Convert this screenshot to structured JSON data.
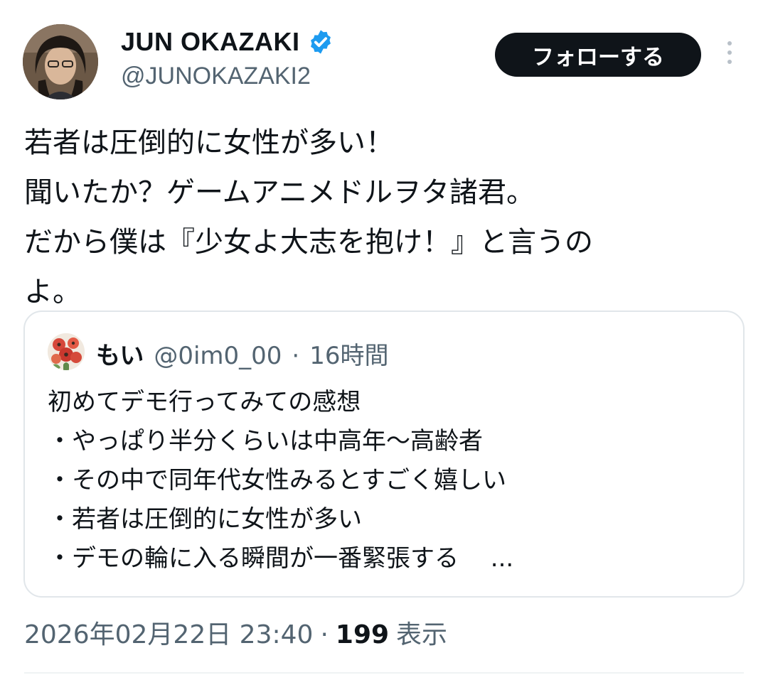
{
  "author": {
    "name": "JUN OKAZAKI",
    "handle": "@JUNOKAZAKI2",
    "verified_color": "#1d9bf0"
  },
  "follow_label": "フォローする",
  "tweet_text": "若者は圧倒的に女性が多い！\n聞いたか？ゲームアニメドルヲタ諸君。\nだから僕は『少女よ大志を抱け！』と言うの\nよ。",
  "quote": {
    "name": "もい",
    "handle": "@0im0_00",
    "sep": "·",
    "time": "16時間",
    "text": "初めてデモ行ってみての感想\n・やっぱり半分くらいは中高年〜高齢者\n・その中で同年代女性みるとすごく嬉しい\n・若者は圧倒的に女性が多い\n・デモの輪に入る瞬間が一番緊張する　 ..."
  },
  "meta": {
    "timestamp": "2026年02月22日 23:40",
    "sep": "·",
    "views": "199",
    "views_label": "表示"
  }
}
